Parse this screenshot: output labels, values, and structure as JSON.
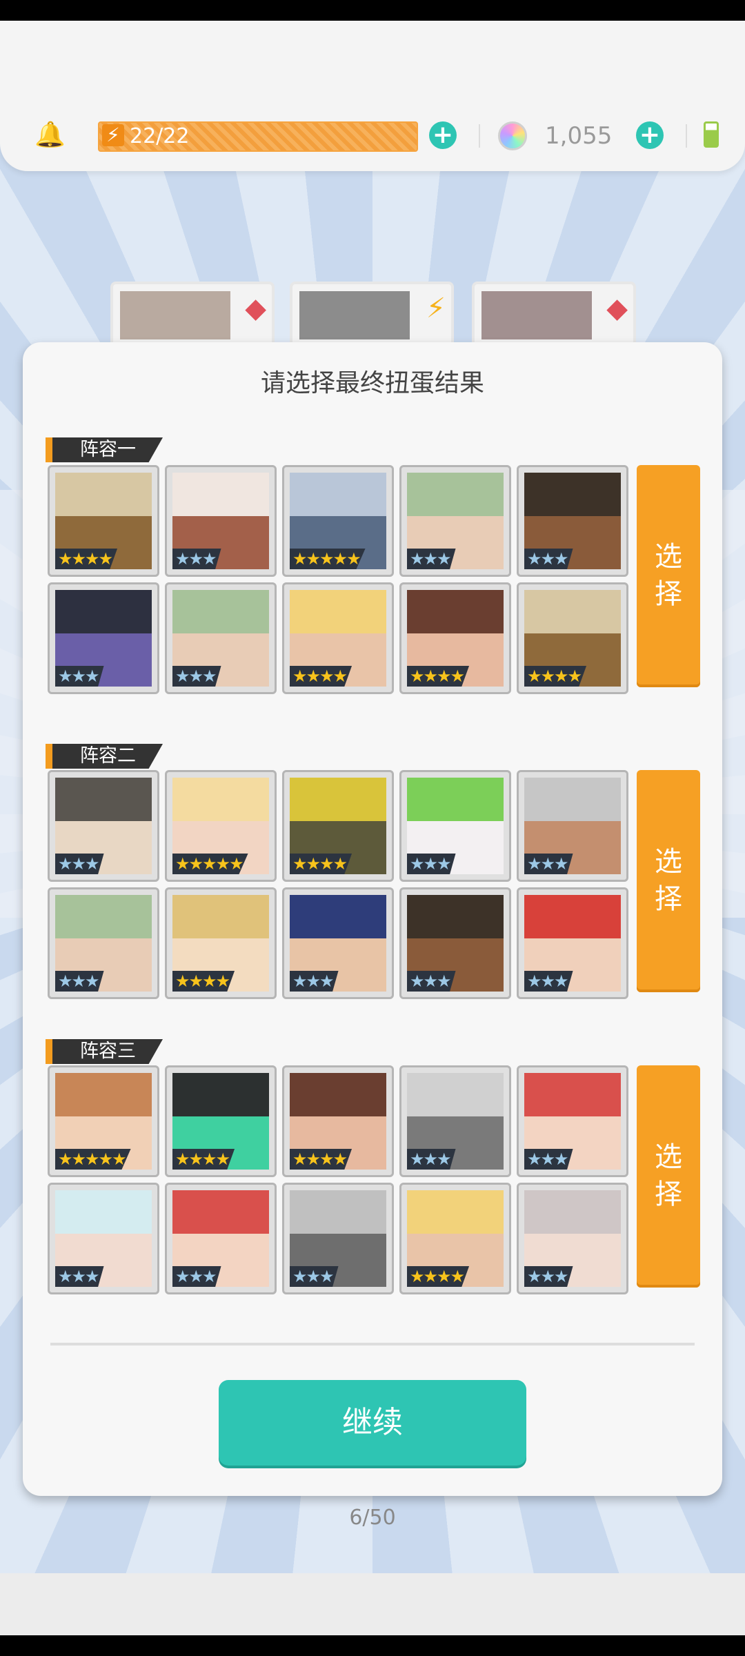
{
  "hud": {
    "energy_text": "22/22",
    "gems_text": "1,055"
  },
  "dialog": {
    "title": "请选择最终扭蛋结果",
    "continue_label": "继续",
    "lineups": [
      {
        "label": "阵容一",
        "select_label": [
          "选",
          "择"
        ],
        "heroes": [
          {
            "stars": 4,
            "colors": [
              "#d7c7a3",
              "#8f6a3b"
            ]
          },
          {
            "stars": 3,
            "colors": [
              "#f0e6e0",
              "#a3604a"
            ]
          },
          {
            "stars": 5,
            "colors": [
              "#b9c6d8",
              "#5a6d88"
            ]
          },
          {
            "stars": 3,
            "colors": [
              "#a7c29a",
              "#e8ccb6"
            ]
          },
          {
            "stars": 3,
            "colors": [
              "#3d3228",
              "#8a5b3a"
            ]
          },
          {
            "stars": 3,
            "colors": [
              "#2d3040",
              "#6a5fa8"
            ]
          },
          {
            "stars": 3,
            "colors": [
              "#a7c29a",
              "#e8ccb6"
            ]
          },
          {
            "stars": 4,
            "colors": [
              "#f2d27a",
              "#e9c4a8"
            ]
          },
          {
            "stars": 4,
            "colors": [
              "#6a3e30",
              "#e7b99f"
            ]
          },
          {
            "stars": 4,
            "colors": [
              "#d7c7a3",
              "#8f6a3b"
            ]
          }
        ]
      },
      {
        "label": "阵容二",
        "select_label": [
          "选",
          "择"
        ],
        "heroes": [
          {
            "stars": 3,
            "colors": [
              "#5a5650",
              "#e8d7c4"
            ]
          },
          {
            "stars": 5,
            "colors": [
              "#f4dba0",
              "#f2d5c3"
            ]
          },
          {
            "stars": 4,
            "colors": [
              "#d9c43a",
              "#5d5a3a"
            ]
          },
          {
            "stars": 3,
            "colors": [
              "#7ccf58",
              "#f3f0f2"
            ]
          },
          {
            "stars": 3,
            "colors": [
              "#c6c6c6",
              "#c48f6f"
            ]
          },
          {
            "stars": 3,
            "colors": [
              "#a7c29a",
              "#e8ccb6"
            ]
          },
          {
            "stars": 4,
            "colors": [
              "#e0c27a",
              "#f3dcc0"
            ]
          },
          {
            "stars": 3,
            "colors": [
              "#2e3d7a",
              "#e8c4a6"
            ]
          },
          {
            "stars": 3,
            "colors": [
              "#3d3228",
              "#8a5b3a"
            ]
          },
          {
            "stars": 3,
            "colors": [
              "#d8413a",
              "#f0d0bb"
            ]
          }
        ]
      },
      {
        "label": "阵容三",
        "select_label": [
          "选",
          "择"
        ],
        "heroes": [
          {
            "stars": 5,
            "colors": [
              "#c88657",
              "#f1d0b6"
            ]
          },
          {
            "stars": 4,
            "colors": [
              "#2c3030",
              "#3fd0a0"
            ]
          },
          {
            "stars": 4,
            "colors": [
              "#6a3e30",
              "#e7b99f"
            ]
          },
          {
            "stars": 3,
            "colors": [
              "#d0d0d0",
              "#7a7a7a"
            ]
          },
          {
            "stars": 3,
            "colors": [
              "#d9504c",
              "#f3d4c2"
            ]
          },
          {
            "stars": 3,
            "colors": [
              "#d4ecf0",
              "#f1dbd0"
            ]
          },
          {
            "stars": 3,
            "colors": [
              "#d9504c",
              "#f3d4c2"
            ]
          },
          {
            "stars": 3,
            "colors": [
              "#c0c0c0",
              "#6e6e6e"
            ]
          },
          {
            "stars": 4,
            "colors": [
              "#f2d27a",
              "#e9c4a8"
            ]
          },
          {
            "stars": 3,
            "colors": [
              "#cfc6c6",
              "#f0dcd2"
            ]
          }
        ]
      }
    ]
  },
  "progress_text": "6/50",
  "colors": {
    "teal": "#2ec5b3",
    "orange": "#f6a024",
    "star_gold": "#f7c31c",
    "star_silver": "#9cc8e6"
  }
}
